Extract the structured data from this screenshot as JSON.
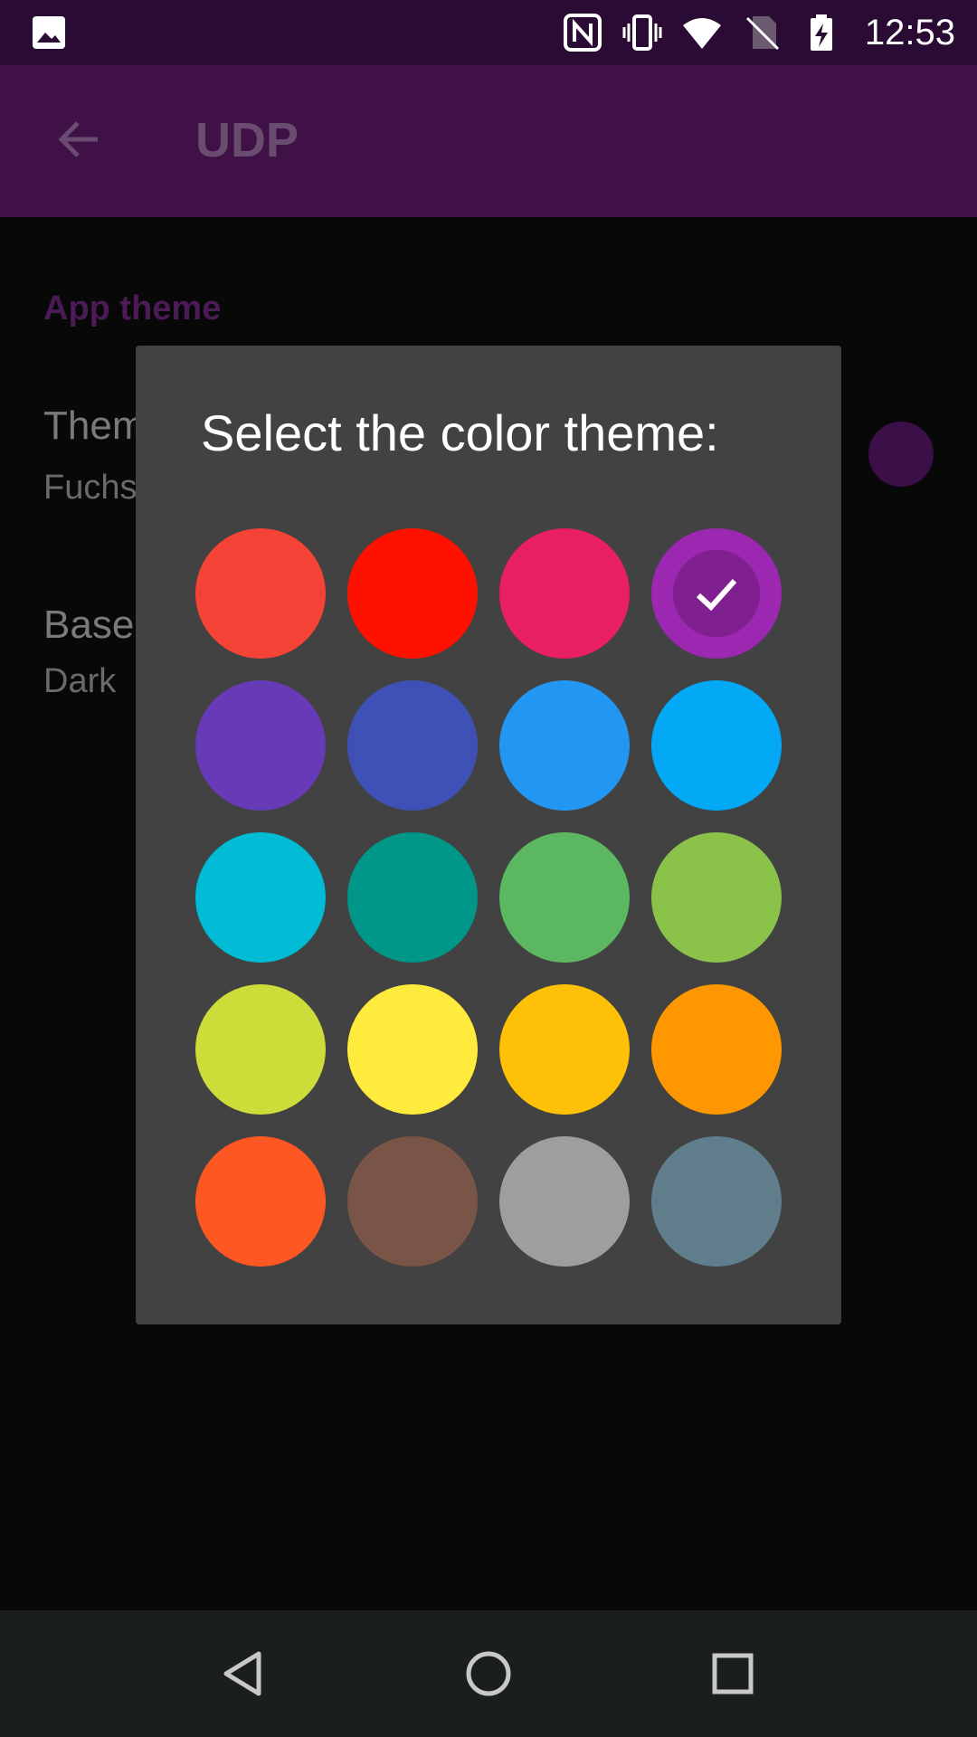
{
  "status_bar": {
    "time": "12:53",
    "icons": [
      "image-icon",
      "nfc-icon",
      "vibrate-icon",
      "wifi-icon",
      "no-sim-icon",
      "battery-charging-icon"
    ]
  },
  "app_bar": {
    "title": "UDP",
    "back_icon": "arrow-back-icon"
  },
  "settings": {
    "section_title": "App theme",
    "theme_pref": {
      "title": "Them",
      "summary": "Fuchs"
    },
    "base_pref": {
      "title": "Base",
      "summary": "Dark"
    },
    "theme_color": "#3b0f47"
  },
  "dialog": {
    "title": "Select the color theme:",
    "selected_index": 3,
    "swatches": [
      "#f44336",
      "#ff1100",
      "#e91e63",
      "#9c27b0",
      "#673ab7",
      "#3f51b5",
      "#2196f3",
      "#03a9f4",
      "#00bcd4",
      "#009688",
      "#5cb860",
      "#8bc34a",
      "#cddc39",
      "#ffeb3b",
      "#ffc107",
      "#ff9800",
      "#ff5722",
      "#795548",
      "#9e9e9e",
      "#607d8b"
    ]
  },
  "nav_bar": {
    "icons": [
      "back-triangle-icon",
      "home-circle-icon",
      "recents-square-icon"
    ]
  }
}
